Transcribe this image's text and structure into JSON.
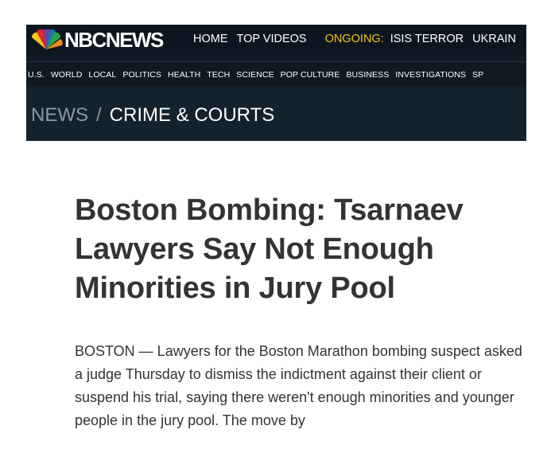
{
  "header": {
    "logo_text": "NBCNEWS",
    "nav": [
      "HOME",
      "TOP VIDEOS"
    ],
    "ongoing_label": "ONGOING:",
    "ongoing_items": [
      "ISIS TERROR",
      "UKRAIN"
    ],
    "sections": [
      "U.S.",
      "WORLD",
      "LOCAL",
      "POLITICS",
      "HEALTH",
      "TECH",
      "SCIENCE",
      "POP CULTURE",
      "BUSINESS",
      "INVESTIGATIONS",
      "SP"
    ]
  },
  "breadcrumb": {
    "root": "NEWS",
    "separator": "/",
    "section": "CRIME & COURTS"
  },
  "article": {
    "headline": "Boston Bombing: Tsarnaev Lawyers Say Not Enough Minorities in Jury Pool",
    "body": "BOSTON — Lawyers for the Boston Marathon bombing suspect asked a judge Thursday to dismiss the indictment against their client or suspend his trial, saying there weren't enough minorities and younger people in the jury pool. The move by"
  },
  "colors": {
    "header_bg": "#101a24",
    "ongoing": "#f5c518",
    "text": "#333333"
  }
}
